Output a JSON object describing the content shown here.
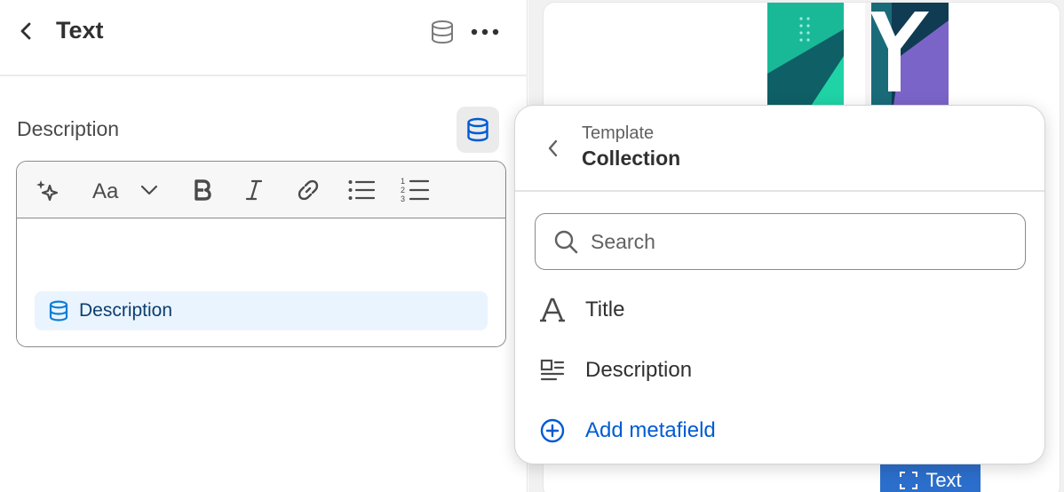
{
  "header": {
    "title": "Text"
  },
  "field": {
    "label": "Description"
  },
  "editor": {
    "chip_label": "Description"
  },
  "preview": {
    "tag_label": "Text"
  },
  "popover": {
    "subtitle": "Template",
    "title": "Collection",
    "search_placeholder": "Search",
    "options": [
      {
        "label": "Title",
        "icon": "text-a-icon"
      },
      {
        "label": "Description",
        "icon": "text-block-icon"
      },
      {
        "label": "Add metafield",
        "icon": "plus-circle-icon"
      }
    ]
  },
  "colors": {
    "accent_blue": "#005bd3",
    "chip_bg": "#eaf4ff",
    "tag_bg": "#2c6ecb",
    "connect_icon": "#005bd3"
  }
}
